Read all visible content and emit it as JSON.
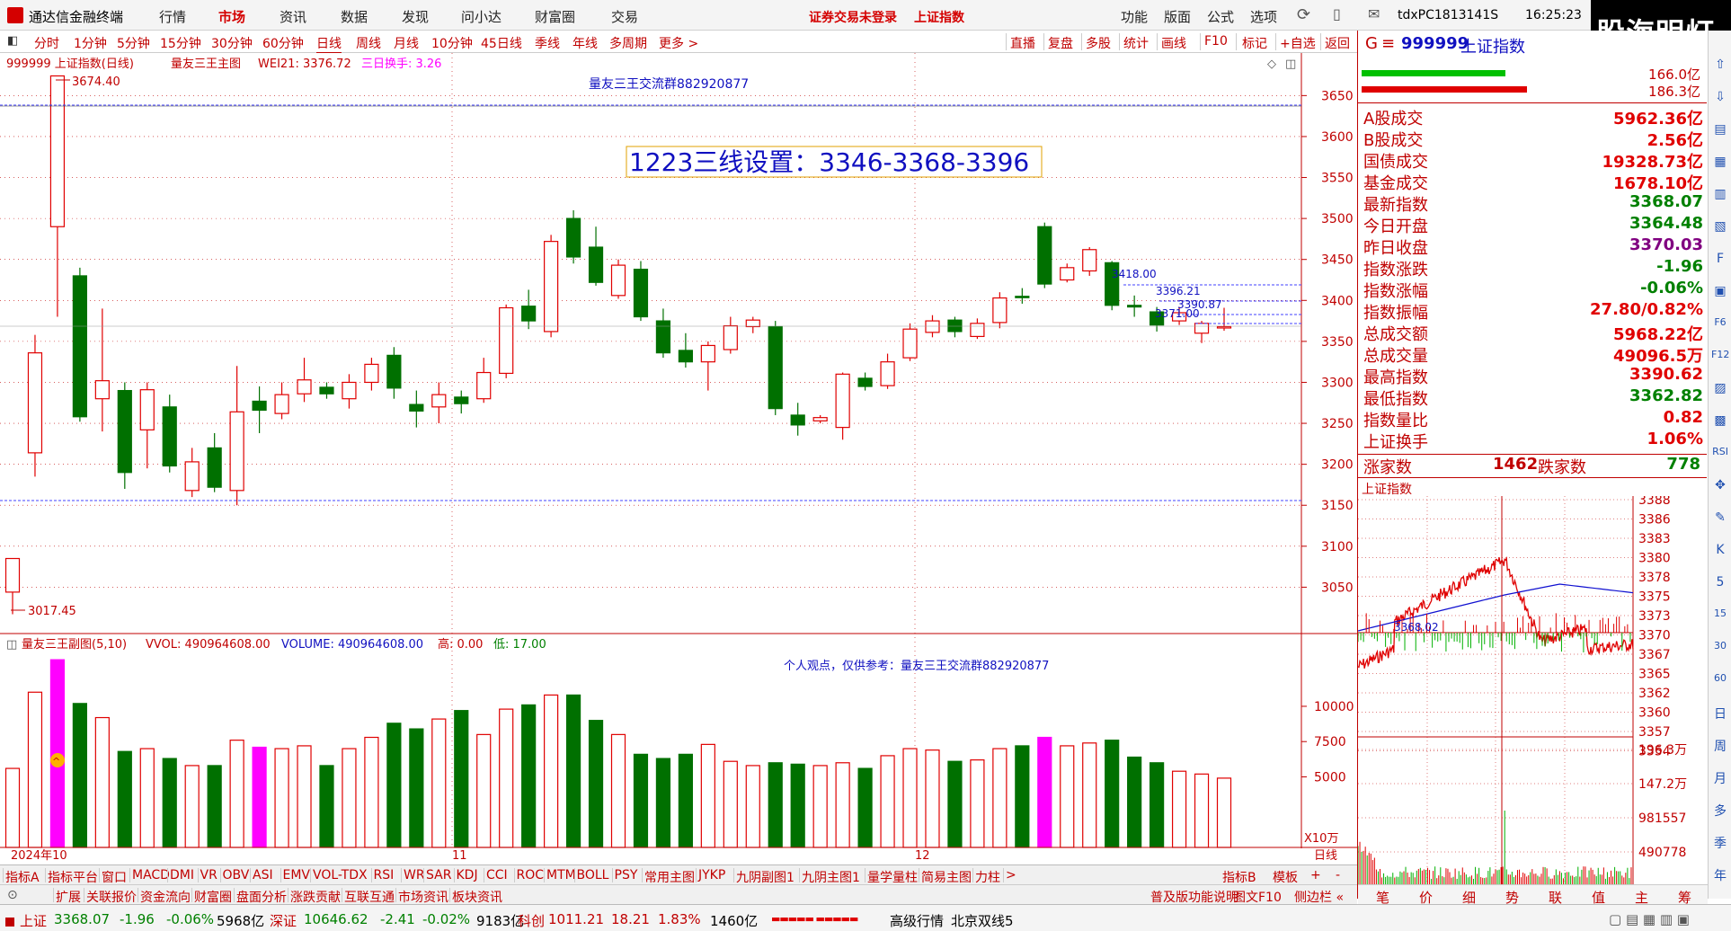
{
  "titlebar": {
    "app_title": "通达信金融终端",
    "menus": [
      "行情",
      "市场",
      "资讯",
      "数据",
      "发现",
      "问小达",
      "财富圈",
      "交易"
    ],
    "active_menu": "市场",
    "notice": "证券交易未登录",
    "notice_index": "上证指数",
    "right_menus": [
      "功能",
      "版面",
      "公式",
      "选项"
    ],
    "account": "tdxPC1813141S",
    "time": "16:25:23",
    "brand": "股海明灯"
  },
  "toolbar": {
    "periods": [
      "分时",
      "1分钟",
      "5分钟",
      "15分钟",
      "30分钟",
      "60分钟",
      "日线",
      "周线",
      "月线",
      "10分钟",
      "45日线",
      "季线",
      "年线",
      "多周期",
      "更多 >"
    ],
    "active_period": "日线",
    "right_buttons": [
      "直播",
      "复盘",
      "多股",
      "统计",
      "画线",
      "F10",
      "标记",
      "+自选",
      "返回"
    ]
  },
  "main_chart": {
    "header_code": "999999 上证指数(日线)",
    "header_indicator": "量友三王主图",
    "wei_label": "WEI21: 3376.72",
    "turnover_label": "三日换手: 3.26",
    "watermark": "量友三王交流群882920877",
    "annotation": "1223三线设置：3346-3368-3396",
    "high_label": "3674.40",
    "low_label": "3017.45",
    "price_marks": [
      "3418.00",
      "3396.21",
      "3390.87",
      "3371.00"
    ],
    "date_labels": [
      "2024年10",
      "11",
      "12"
    ]
  },
  "sub_chart": {
    "header_indicator": "量友三王副图(5,10)",
    "vvol_label": "VVOL: 490964608.00",
    "volume_label": "VOLUME: 490964608.00",
    "high_label": "高: 0.00",
    "low_label": "低: 17.00",
    "note": "个人观点，仅供参考：量友三王交流群882920877",
    "unit_label": "X10万",
    "period_label": "日线"
  },
  "chart_data": {
    "type": "candlestick",
    "symbol": "999999 上证指数",
    "ylim": [
      3000,
      3680
    ],
    "y_ticks": [
      3050,
      3100,
      3150,
      3200,
      3250,
      3300,
      3350,
      3400,
      3450,
      3500,
      3550,
      3600,
      3650
    ],
    "volume_ticks": [
      5000,
      7500,
      10000
    ],
    "volume_ylim": [
      0,
      13500
    ],
    "candles": [
      {
        "o": 3044,
        "c": 3085,
        "h": 3085,
        "l": 3017,
        "v": 5600,
        "up": true
      },
      {
        "o": 3214,
        "c": 3336,
        "h": 3358,
        "l": 3185,
        "v": 11000,
        "up": true
      },
      {
        "o": 3490,
        "c": 3674,
        "h": 3674,
        "l": 3380,
        "v": 13300,
        "up": true,
        "highlight": true
      },
      {
        "o": 3430,
        "c": 3258,
        "h": 3440,
        "l": 3252,
        "v": 10200,
        "up": false
      },
      {
        "o": 3280,
        "c": 3302,
        "h": 3390,
        "l": 3240,
        "v": 9200,
        "up": true
      },
      {
        "o": 3290,
        "c": 3190,
        "h": 3300,
        "l": 3170,
        "v": 6800,
        "up": false
      },
      {
        "o": 3242,
        "c": 3291,
        "h": 3300,
        "l": 3195,
        "v": 7000,
        "up": true
      },
      {
        "o": 3270,
        "c": 3198,
        "h": 3285,
        "l": 3190,
        "v": 6300,
        "up": false
      },
      {
        "o": 3168,
        "c": 3203,
        "h": 3220,
        "l": 3160,
        "v": 5800,
        "up": true
      },
      {
        "o": 3220,
        "c": 3172,
        "h": 3238,
        "l": 3166,
        "v": 5800,
        "up": false
      },
      {
        "o": 3168,
        "c": 3264,
        "h": 3320,
        "l": 3150,
        "v": 7600,
        "up": true
      },
      {
        "o": 3277,
        "c": 3266,
        "h": 3295,
        "l": 3238,
        "v": 7100,
        "up": false,
        "highlight": true
      },
      {
        "o": 3262,
        "c": 3285,
        "h": 3300,
        "l": 3255,
        "v": 7000,
        "up": true
      },
      {
        "o": 3286,
        "c": 3303,
        "h": 3330,
        "l": 3276,
        "v": 7200,
        "up": true
      },
      {
        "o": 3294,
        "c": 3286,
        "h": 3300,
        "l": 3280,
        "v": 5800,
        "up": false
      },
      {
        "o": 3280,
        "c": 3300,
        "h": 3310,
        "l": 3268,
        "v": 7000,
        "up": true
      },
      {
        "o": 3300,
        "c": 3322,
        "h": 3330,
        "l": 3290,
        "v": 7800,
        "up": true
      },
      {
        "o": 3333,
        "c": 3293,
        "h": 3343,
        "l": 3280,
        "v": 8800,
        "up": false
      },
      {
        "o": 3273,
        "c": 3265,
        "h": 3290,
        "l": 3245,
        "v": 8400,
        "up": false
      },
      {
        "o": 3270,
        "c": 3285,
        "h": 3300,
        "l": 3250,
        "v": 9100,
        "up": true
      },
      {
        "o": 3282,
        "c": 3274,
        "h": 3290,
        "l": 3262,
        "v": 9700,
        "up": false
      },
      {
        "o": 3280,
        "c": 3312,
        "h": 3330,
        "l": 3275,
        "v": 8000,
        "up": true
      },
      {
        "o": 3311,
        "c": 3391,
        "h": 3395,
        "l": 3305,
        "v": 9800,
        "up": true
      },
      {
        "o": 3393,
        "c": 3375,
        "h": 3413,
        "l": 3365,
        "v": 10100,
        "up": false
      },
      {
        "o": 3362,
        "c": 3472,
        "h": 3480,
        "l": 3355,
        "v": 10800,
        "up": true
      },
      {
        "o": 3500,
        "c": 3453,
        "h": 3510,
        "l": 3445,
        "v": 10800,
        "up": false
      },
      {
        "o": 3465,
        "c": 3422,
        "h": 3490,
        "l": 3418,
        "v": 9000,
        "up": false
      },
      {
        "o": 3406,
        "c": 3443,
        "h": 3450,
        "l": 3402,
        "v": 8000,
        "up": true
      },
      {
        "o": 3438,
        "c": 3380,
        "h": 3448,
        "l": 3375,
        "v": 6600,
        "up": false
      },
      {
        "o": 3375,
        "c": 3336,
        "h": 3390,
        "l": 3330,
        "v": 6300,
        "up": false
      },
      {
        "o": 3339,
        "c": 3325,
        "h": 3360,
        "l": 3318,
        "v": 6600,
        "up": false
      },
      {
        "o": 3325,
        "c": 3345,
        "h": 3350,
        "l": 3290,
        "v": 7300,
        "up": true
      },
      {
        "o": 3340,
        "c": 3369,
        "h": 3380,
        "l": 3335,
        "v": 6100,
        "up": true
      },
      {
        "o": 3368,
        "c": 3376,
        "h": 3380,
        "l": 3360,
        "v": 5800,
        "up": true
      },
      {
        "o": 3368,
        "c": 3268,
        "h": 3375,
        "l": 3260,
        "v": 6000,
        "up": false
      },
      {
        "o": 3260,
        "c": 3248,
        "h": 3275,
        "l": 3235,
        "v": 5900,
        "up": false
      },
      {
        "o": 3257,
        "c": 3253,
        "h": 3260,
        "l": 3250,
        "v": 5800,
        "up": true
      },
      {
        "o": 3245,
        "c": 3310,
        "h": 3312,
        "l": 3230,
        "v": 6000,
        "up": true
      },
      {
        "o": 3305,
        "c": 3295,
        "h": 3312,
        "l": 3290,
        "v": 5600,
        "up": false
      },
      {
        "o": 3296,
        "c": 3325,
        "h": 3335,
        "l": 3292,
        "v": 6500,
        "up": true
      },
      {
        "o": 3330,
        "c": 3365,
        "h": 3372,
        "l": 3326,
        "v": 7000,
        "up": true
      },
      {
        "o": 3361,
        "c": 3375,
        "h": 3382,
        "l": 3355,
        "v": 6900,
        "up": true
      },
      {
        "o": 3376,
        "c": 3362,
        "h": 3380,
        "l": 3355,
        "v": 6100,
        "up": false
      },
      {
        "o": 3356,
        "c": 3372,
        "h": 3378,
        "l": 3353,
        "v": 6200,
        "up": true
      },
      {
        "o": 3373,
        "c": 3403,
        "h": 3410,
        "l": 3366,
        "v": 7000,
        "up": true
      },
      {
        "o": 3405,
        "c": 3405,
        "h": 3415,
        "l": 3396,
        "v": 7200,
        "up": false
      },
      {
        "o": 3420,
        "c": 3490,
        "h": 3495,
        "l": 3415,
        "v": 7800,
        "up": false,
        "highlight": true
      },
      {
        "o": 3425,
        "c": 3440,
        "h": 3445,
        "l": 3422,
        "v": 7200,
        "up": true
      },
      {
        "o": 3436,
        "c": 3462,
        "h": 3465,
        "l": 3430,
        "v": 7400,
        "up": true
      },
      {
        "o": 3446,
        "c": 3394,
        "h": 3448,
        "l": 3388,
        "v": 7600,
        "up": false
      },
      {
        "o": 3392,
        "c": 3394,
        "h": 3406,
        "l": 3380,
        "v": 6400,
        "up": false
      },
      {
        "o": 3370,
        "c": 3386,
        "h": 3392,
        "l": 3362,
        "v": 6000,
        "up": false
      },
      {
        "o": 3375,
        "c": 3385,
        "h": 3392,
        "l": 3370,
        "v": 5400,
        "up": true
      },
      {
        "o": 3360,
        "c": 3372,
        "h": 3375,
        "l": 3348,
        "v": 5200,
        "up": true
      },
      {
        "o": 3368,
        "c": 3368,
        "h": 3391,
        "l": 3363,
        "v": 4910,
        "up": true
      }
    ]
  },
  "right_panel": {
    "code": "999999",
    "name": "上证指数",
    "prefix": "G",
    "bar_top_value": "166.0亿",
    "bar_bottom_value": "186.3亿",
    "rows": [
      {
        "label": "A股成交",
        "value": "5962.36亿",
        "color": "red"
      },
      {
        "label": "B股成交",
        "value": "2.56亿",
        "color": "red"
      },
      {
        "label": "国债成交",
        "value": "19328.73亿",
        "color": "red"
      },
      {
        "label": "基金成交",
        "value": "1678.10亿",
        "color": "red"
      },
      {
        "label": "最新指数",
        "value": "3368.07",
        "color": "green"
      },
      {
        "label": "今日开盘",
        "value": "3364.48",
        "color": "green"
      },
      {
        "label": "昨日收盘",
        "value": "3370.03",
        "color": "purple"
      },
      {
        "label": "指数涨跌",
        "value": "-1.96",
        "color": "green"
      },
      {
        "label": "指数涨幅",
        "value": "-0.06%",
        "color": "green"
      },
      {
        "label": "指数振幅",
        "value": "27.80/0.82%",
        "color": "red"
      },
      {
        "label": "总成交额",
        "value": "5968.22亿",
        "color": "red"
      },
      {
        "label": "总成交量",
        "value": "49096.5万",
        "color": "red"
      },
      {
        "label": "最高指数",
        "value": "3390.62",
        "color": "red"
      },
      {
        "label": "最低指数",
        "value": "3362.82",
        "color": "green"
      },
      {
        "label": "指数量比",
        "value": "0.82",
        "color": "red"
      },
      {
        "label": "上证换手",
        "value": "1.06%",
        "color": "red"
      }
    ],
    "up_label": "涨家数",
    "up_count": "1462",
    "down_label": "跌家数",
    "down_count": "778",
    "mini_title": "上证指数",
    "mini_ticks": [
      "3388",
      "3386",
      "3383",
      "3380",
      "3378",
      "3375",
      "3373",
      "3370",
      "3367",
      "3365",
      "3362",
      "3360",
      "3357",
      "3354"
    ],
    "mini_vol_ticks": [
      "196.3万",
      "147.2万",
      "981557",
      "490778"
    ],
    "mini_mark": "3368.02",
    "bottom_tabs": [
      "笔",
      "价",
      "细",
      "势",
      "联",
      "值",
      "主",
      "筹"
    ]
  },
  "side_icons": [
    "up-arrow",
    "down-arrow",
    "list",
    "grid",
    "chart",
    "chart2",
    "f10",
    "card",
    "f6",
    "f12",
    "chart3",
    "chart4",
    "rsi",
    "move",
    "pen",
    "k",
    "5",
    "15",
    "30",
    "60",
    "日",
    "周",
    "月",
    "多",
    "季",
    "年"
  ],
  "bottom_tabs": {
    "row1": [
      "指标A",
      "指标平台",
      "窗口",
      "MACD",
      "DMI",
      "VR",
      "OBV",
      "ASI",
      "EMV",
      "VOL-TDX",
      "RSI",
      "WR",
      "SAR",
      "KDJ",
      "CCI",
      "ROC",
      "MTM",
      "BOLL",
      "PSY",
      "常用主图",
      "JYKP",
      "九阴副图1",
      "九阴主图1",
      "量学量柱",
      "简易主图",
      "力柱",
      ">",
      "指标B",
      "模板",
      "+",
      "-"
    ],
    "row2": [
      "扩展",
      "关联报价",
      "资金流向",
      "财富圈",
      "盘面分析",
      "涨跌贡献",
      "互联互通",
      "市场资讯",
      "板块资讯"
    ],
    "row2_right": [
      "普及版功能说明",
      "图文F10",
      "侧边栏 «"
    ]
  },
  "statusbar": {
    "sh_label": "上证",
    "sh_value": "3368.07",
    "sh_change": "-1.96",
    "sh_pct": "-0.06%",
    "sh_amount": "5968亿",
    "sz_label": "深证",
    "sz_value": "10646.62",
    "sz_change": "-2.41",
    "sz_pct": "-0.02%",
    "sz_amount": "9183亿",
    "kc_label": "科创",
    "kc_value": "1011.21",
    "kc_change": "18.21",
    "kc_pct": "1.83%",
    "kc_amount": "1460亿",
    "line_label": "高级行情",
    "server": "北京双线5"
  },
  "colors": {
    "up": "#e00000",
    "down": "#007000",
    "highlight": "#ff00ff",
    "grid": "#c00000",
    "axis_text": "#c00000"
  }
}
